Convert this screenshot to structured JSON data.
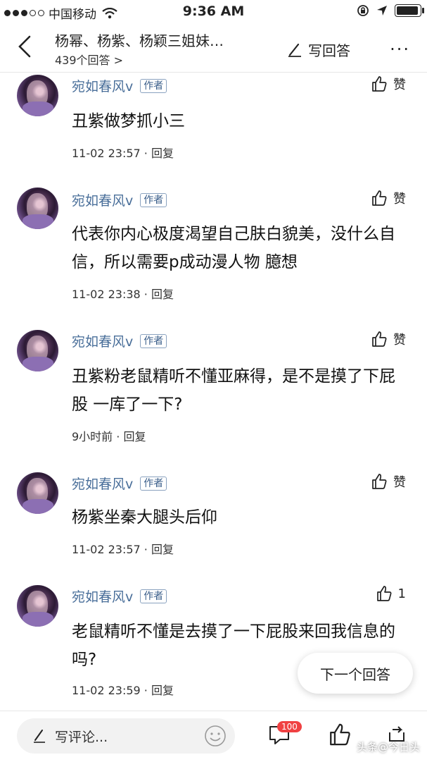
{
  "status_bar": {
    "carrier": "中国移动",
    "time": "9:36 AM"
  },
  "header": {
    "title": "杨幂、杨紫、杨颖三姐妹…",
    "answer_count": "439个回答 >",
    "write_answer": "写回答",
    "more": "···"
  },
  "comments": [
    {
      "author": "宛如春风v",
      "tag": "作者",
      "like": "赞",
      "text": "丑紫做梦抓小三",
      "time": "11-02 23:57",
      "reply": "· 回复"
    },
    {
      "author": "宛如春风v",
      "tag": "作者",
      "like": "赞",
      "text": "代表你内心极度渴望自己肤白貌美，没什么自信，所以需要p成动漫人物 臆想",
      "time": "11-02 23:38",
      "reply": "· 回复"
    },
    {
      "author": "宛如春风v",
      "tag": "作者",
      "like": "赞",
      "text": "丑紫粉老鼠精听不懂亚麻得，是不是摸了下屁股 一库了一下?",
      "time": "9小时前",
      "reply": "· 回复"
    },
    {
      "author": "宛如春风v",
      "tag": "作者",
      "like": "赞",
      "text": "杨紫坐秦大腿头后仰",
      "time": "11-02 23:57",
      "reply": "· 回复"
    },
    {
      "author": "宛如春风v",
      "tag": "作者",
      "like": "1",
      "text": "老鼠精听不懂是去摸了一下屁股来回我信息的吗?",
      "time": "11-02 23:59",
      "reply": "· 回复"
    }
  ],
  "next_answer": "下一个回答",
  "bottom_bar": {
    "comment_placeholder": "写评论...",
    "comment_badge": "100",
    "watermark": "头条@今日头"
  }
}
